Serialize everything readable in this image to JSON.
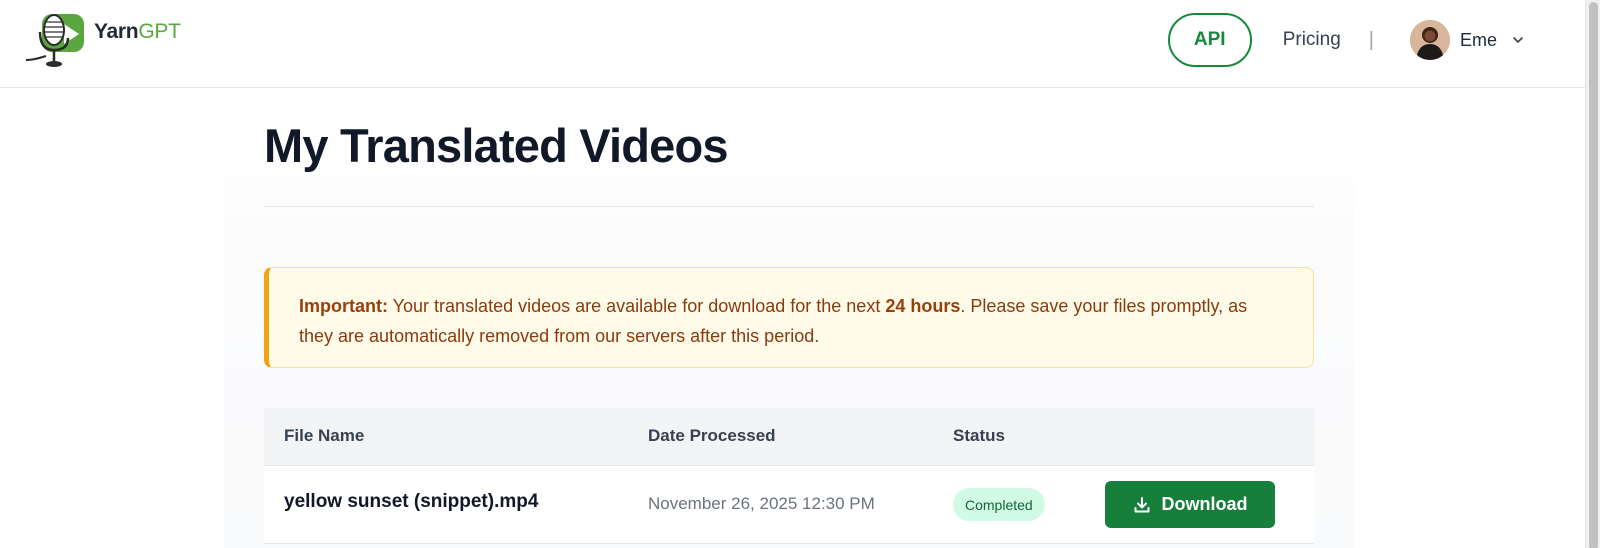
{
  "brand": {
    "name_part1": "Yarn",
    "name_part2": "GPT",
    "accent_green": "#168a3b",
    "logo_green": "#5aa63f"
  },
  "nav": {
    "api_label": "API",
    "pricing_label": "Pricing",
    "separator": "|",
    "user_name": "Eme",
    "user_menu_icon": "chevron-down-icon"
  },
  "page": {
    "title": "My Translated Videos"
  },
  "notice": {
    "label": "Important:",
    "text_before": " Your translated videos are available for download for the next ",
    "highlight": "24 hours",
    "text_after": ". Please save your files promptly, as they are automatically removed from our servers after this period.",
    "border_color": "#f2a215"
  },
  "table": {
    "columns": [
      "File Name",
      "Date Processed",
      "Status",
      ""
    ],
    "rows": [
      {
        "file_name": "yellow sunset (snippet).mp4",
        "date_processed": "November 26, 2025 12:30 PM",
        "status": "Completed",
        "action_label": "Download",
        "action_icon": "download-icon"
      }
    ]
  }
}
